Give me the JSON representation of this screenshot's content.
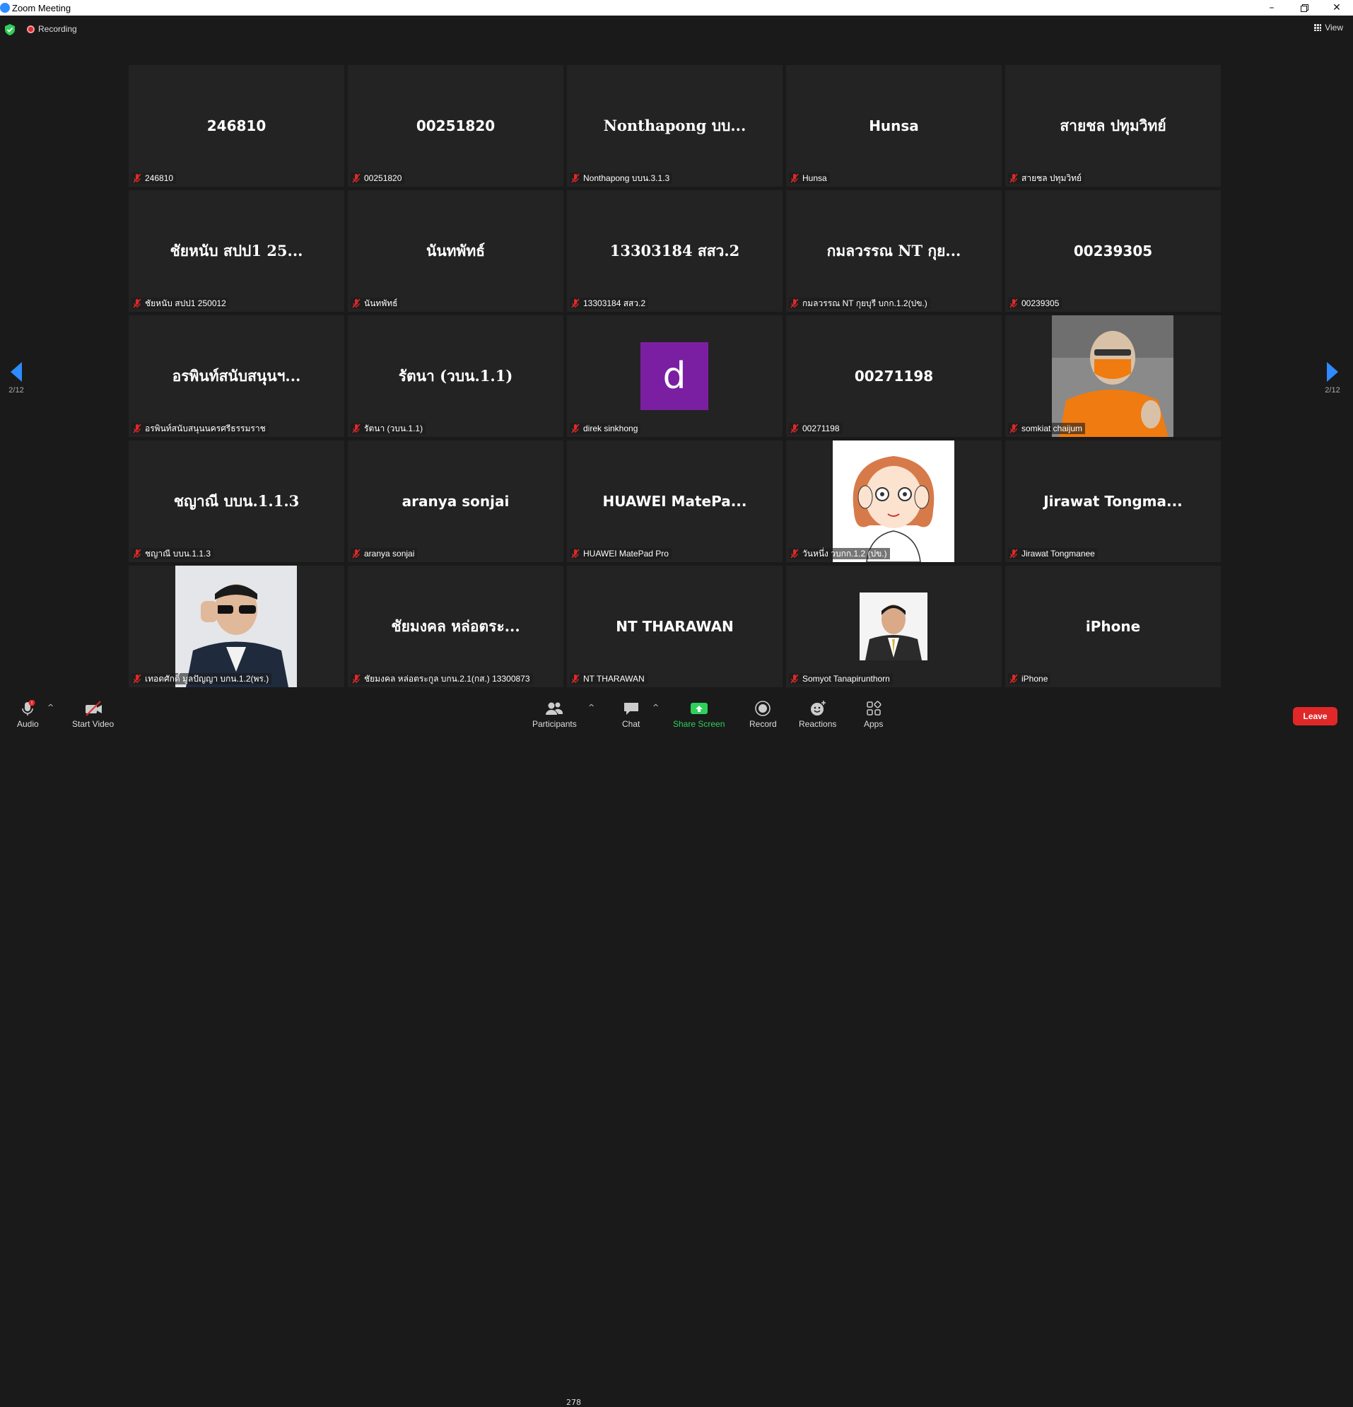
{
  "window": {
    "title": "Zoom Meeting"
  },
  "topbar": {
    "recording_label": "Recording",
    "view_label": "View"
  },
  "pagination": {
    "left": "2/12",
    "right": "2/12"
  },
  "tiles": [
    {
      "big": "246810",
      "label": "246810"
    },
    {
      "big": "00251820",
      "label": "00251820"
    },
    {
      "big": "Nonthapong บบ...",
      "label": "Nonthapong บบน.3.1.3"
    },
    {
      "big": "Hunsa",
      "label": "Hunsa"
    },
    {
      "big": "สายชล ปทุมวิทย์",
      "label": "สายชล ปทุมวิทย์"
    },
    {
      "big": "ชัยหนับ สปป1 25...",
      "label": "ชัยหนับ สปป1 250012"
    },
    {
      "big": "นันทพัทธ์",
      "label": "นันทพัทธ์"
    },
    {
      "big": "13303184 สสว.2",
      "label": "13303184 สสว.2"
    },
    {
      "big": "กมลวรรณ NT กุย...",
      "label": "กมลวรรณ NT กุยบุรี บกก.1.2(ปข.)"
    },
    {
      "big": "00239305",
      "label": "00239305"
    },
    {
      "big": "อรพินท์สนับสนุนฯ...",
      "label": "อรพินท์สนับสนุนนครศรีธรรมราช"
    },
    {
      "big": "รัตนา (วบน.1.1)",
      "label": "รัตนา (วบน.1.1)"
    },
    {
      "big": "",
      "avatar_letter": "d",
      "label": "direk sinkhong"
    },
    {
      "big": "00271198",
      "label": "00271198"
    },
    {
      "big": "",
      "photo": "man-orange",
      "label": "somkiat chaijum"
    },
    {
      "big": "ชญาณี บบน.1.1.3",
      "label": "ชญาณี บบน.1.1.3"
    },
    {
      "big": "aranya sonjai",
      "label": "aranya sonjai"
    },
    {
      "big": "HUAWEI MatePa...",
      "label": "HUAWEI MatePad Pro"
    },
    {
      "big": "",
      "photo": "cartoon-girl",
      "label": "วันหนึ่ง วบกก.1.2 (ปข.)"
    },
    {
      "big": "Jirawat Tongma...",
      "label": "Jirawat Tongmanee"
    },
    {
      "big": "",
      "photo": "man-sunglasses",
      "label": "เทอดศักดิ์ มูลปัญญา บกน.1.2(พร.)"
    },
    {
      "big": "ชัยมงคล หล่อตระ...",
      "label": "ชัยมงคล หล่อตระกูล บกน.2.1(กส.) 13300873"
    },
    {
      "big": "NT THARAWAN",
      "label": "NT THARAWAN"
    },
    {
      "big": "",
      "photo": "man-suit",
      "label": "Somyot Tanapirunthorn"
    },
    {
      "big": "iPhone",
      "label": "iPhone"
    }
  ],
  "toolbar": {
    "audio": "Audio",
    "start_video": "Start Video",
    "participants": "Participants",
    "participants_count": "278",
    "chat": "Chat",
    "share_screen": "Share Screen",
    "record": "Record",
    "reactions": "Reactions",
    "apps": "Apps",
    "leave": "Leave"
  },
  "colors": {
    "share_green": "#2fcf59",
    "leave_red": "#e02828",
    "avatar_purple": "#7b1fa2",
    "nav_blue": "#2d8cff"
  }
}
